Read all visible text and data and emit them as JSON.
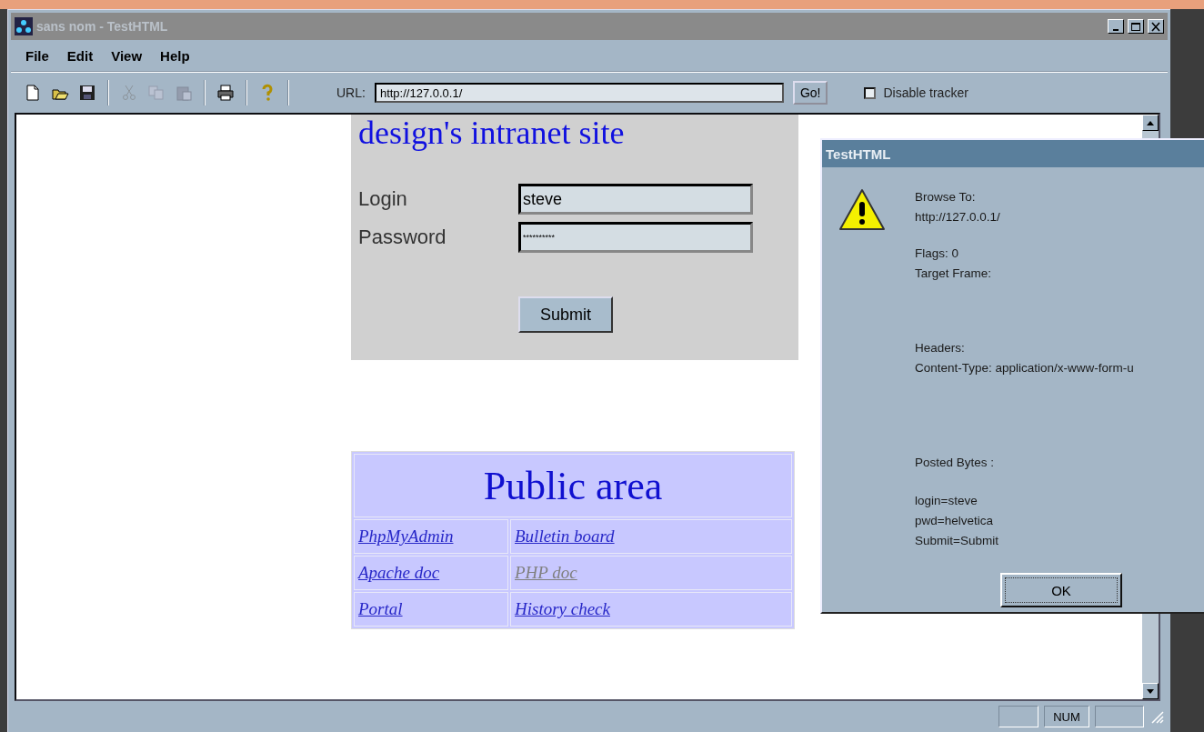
{
  "window": {
    "title": "sans nom - TestHTML"
  },
  "menu": [
    {
      "label": "File"
    },
    {
      "label": "Edit"
    },
    {
      "label": "View"
    },
    {
      "label": "Help"
    }
  ],
  "toolbar": {
    "buttons": [
      {
        "kind": "new",
        "disabled": false
      },
      {
        "kind": "open",
        "disabled": false
      },
      {
        "kind": "save",
        "disabled": false
      },
      {
        "kind": "cut",
        "disabled": true
      },
      {
        "kind": "copy",
        "disabled": true
      },
      {
        "kind": "paste",
        "disabled": true
      },
      {
        "kind": "print",
        "disabled": false
      },
      {
        "kind": "help",
        "disabled": false
      }
    ],
    "url_label": "URL:",
    "url": "http://127.0.0.1/",
    "go": "Go!",
    "tracker": {
      "label": "Disable tracker",
      "checked": false
    }
  },
  "page": {
    "heading": "design's intranet site",
    "fields": [
      {
        "label": "Login",
        "value": "steve"
      },
      {
        "label": "Password",
        "value": "**********"
      }
    ],
    "submit": "Submit",
    "public": {
      "title": "Public area",
      "rows": [
        [
          {
            "label": "PhpMyAdmin",
            "visited": false
          },
          {
            "label": "Bulletin board",
            "visited": false
          }
        ],
        [
          {
            "label": "Apache doc",
            "visited": false
          },
          {
            "label": "PHP doc",
            "visited": true
          }
        ],
        [
          {
            "label": "Portal",
            "visited": false
          },
          {
            "label": "History check",
            "visited": false
          }
        ]
      ]
    }
  },
  "dialog": {
    "title": "TestHTML",
    "blocks": [
      [
        "Browse To:",
        "http://127.0.0.1/"
      ],
      [
        "Flags: 0",
        "Target Frame:"
      ],
      [
        "Headers:",
        "Content-Type: application/x-www-form-u"
      ],
      [
        "Posted Bytes :"
      ],
      [
        "login=steve",
        "pwd=helvetica",
        "Submit=Submit"
      ]
    ],
    "ok": "OK"
  },
  "status_bar": {
    "panes": [
      {
        "kind": "blank"
      },
      {
        "kind": "text",
        "label": "NUM"
      },
      {
        "kind": "blank"
      }
    ]
  }
}
